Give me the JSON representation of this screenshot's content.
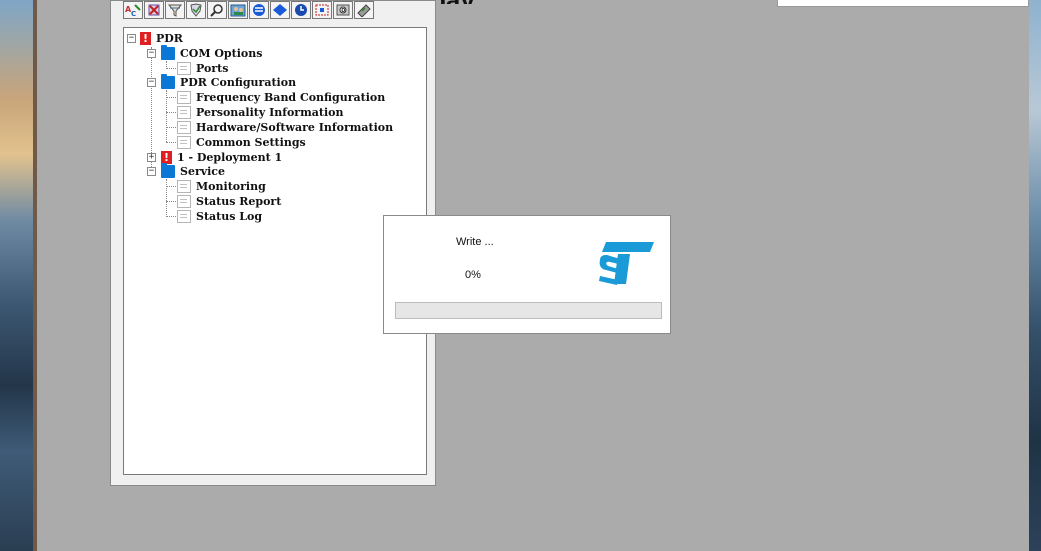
{
  "background": {
    "title_fragment": "pay"
  },
  "toolbar": {
    "buttons": [
      {
        "name": "abc-icon"
      },
      {
        "name": "erase-icon"
      },
      {
        "name": "funnel-icon"
      },
      {
        "name": "shield-icon"
      },
      {
        "name": "magnifier-icon"
      },
      {
        "name": "people-icon"
      },
      {
        "name": "stack-icon"
      },
      {
        "name": "diamond-icon"
      },
      {
        "name": "clock-icon"
      },
      {
        "name": "bracket-icon"
      },
      {
        "name": "device-icon"
      },
      {
        "name": "chip-icon"
      }
    ]
  },
  "tree": {
    "root": {
      "label": "PDR",
      "icon": "alert-icon",
      "expanded": true
    },
    "com_options": {
      "label": "COM Options",
      "expanded": true
    },
    "ports": {
      "label": "Ports"
    },
    "pdr_configuration": {
      "label": "PDR Configuration",
      "expanded": true
    },
    "frequency_band": {
      "label": "Frequency Band Configuration"
    },
    "personality": {
      "label": "Personality Information"
    },
    "hw_sw": {
      "label": "Hardware/Software Information"
    },
    "common": {
      "label": "Common Settings"
    },
    "deployment": {
      "label": "1 - Deployment 1",
      "icon": "alert-icon",
      "expanded": false
    },
    "service": {
      "label": "Service",
      "expanded": true
    },
    "monitoring": {
      "label": "Monitoring"
    },
    "status_report": {
      "label": "Status Report"
    },
    "status_log": {
      "label": "Status Log"
    }
  },
  "dialog": {
    "status_text": "Write ...",
    "percent_text": "0%",
    "progress_fraction": 0.0,
    "logo": "company-logo-icon",
    "logo_color": "#1a9ad6"
  },
  "colors": {
    "folder": "#0a78d4",
    "alert": "#e02020",
    "workspace": "#ababab"
  }
}
